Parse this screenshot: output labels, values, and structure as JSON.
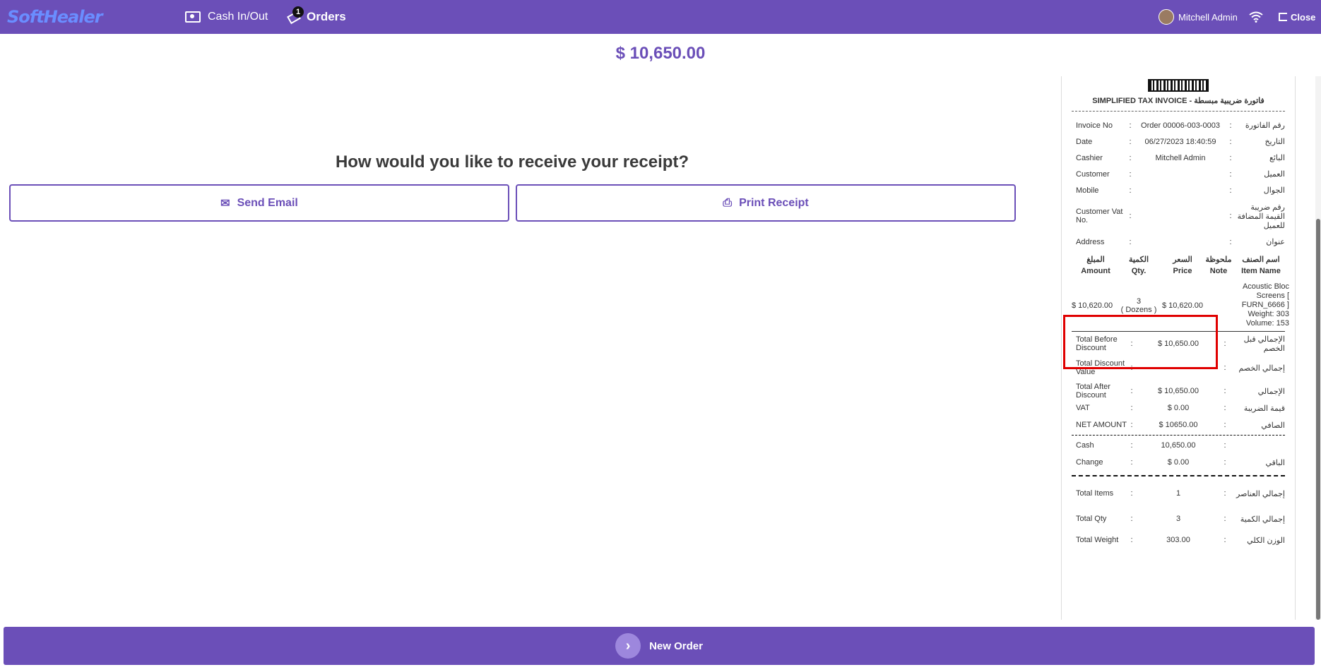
{
  "topbar": {
    "logo": "SoftHealer",
    "cash_inout": "Cash In/Out",
    "orders": "Orders",
    "orders_badge": "1",
    "user": "Mitchell Admin",
    "close": "Close"
  },
  "main": {
    "total": "$ 10,650.00",
    "question": "How would you like to receive your receipt?",
    "send_email": "Send Email",
    "print_receipt": "Print Receipt"
  },
  "receipt": {
    "title": "SIMPLIFIED TAX INVOICE - فاتورة ضريبية مبسطة",
    "info": [
      {
        "en": "Invoice No",
        "value": "Order 00006-003-0003",
        "ar": "رقم الفاتورة"
      },
      {
        "en": "Date",
        "value": "06/27/2023 18:40:59",
        "ar": "التاريخ"
      },
      {
        "en": "Cashier",
        "value": "Mitchell Admin",
        "ar": "البائع"
      },
      {
        "en": "Customer",
        "value": "",
        "ar": "العميل"
      },
      {
        "en": "Mobile",
        "value": "",
        "ar": "الجوال"
      },
      {
        "en": "Customer Vat No.",
        "value": "",
        "ar": "رقم ضريبة القيمة المضافة للعميل"
      },
      {
        "en": "Address",
        "value": "",
        "ar": "عنوان"
      }
    ],
    "item_header": {
      "amount_ar": "المبلغ",
      "amount_en": "Amount",
      "qty_ar": "الكمية",
      "qty_en": "Qty.",
      "price_ar": "السعر",
      "price_en": "Price",
      "note_ar": "ملحوظة",
      "note_en": "Note",
      "name_ar": "اسم الصنف",
      "name_en": "Item Name"
    },
    "item": {
      "amount": "$ 10,620.00",
      "qty": "3",
      "uom": "( Dozens )",
      "price": "$ 10,620.00",
      "name": "Acoustic Bloc Screens [ FURN_6666 ] Weight: 303 Volume: 153"
    },
    "totals": [
      {
        "en": "Total Before Discount",
        "value": "$ 10,650.00",
        "ar": "الإجمالي قبل الخصم"
      },
      {
        "en": "Total Discount Value",
        "value": "",
        "ar": "إجمالي الخصم"
      },
      {
        "en": "Total After Discount",
        "value": "$ 10,650.00",
        "ar": "الإجمالي"
      },
      {
        "en": "VAT",
        "value": "$ 0.00",
        "ar": "قيمة الضريبة"
      },
      {
        "en": "NET AMOUNT",
        "value": "$ 10650.00",
        "ar": "الصافي"
      }
    ],
    "payments": [
      {
        "en": "Cash",
        "value": "10,650.00",
        "ar": ""
      },
      {
        "en": "Change",
        "value": "$ 0.00",
        "ar": "الباقي"
      }
    ],
    "summary": [
      {
        "en": "Total Items",
        "value": "1",
        "ar": "إجمالي العناصر"
      },
      {
        "en": "Total Qty",
        "value": "3",
        "ar": "إجمالي الكمية"
      },
      {
        "en": "Total Weight",
        "value": "303.00",
        "ar": "الوزن الكلي"
      }
    ]
  },
  "footer": {
    "new_order": "New Order"
  }
}
